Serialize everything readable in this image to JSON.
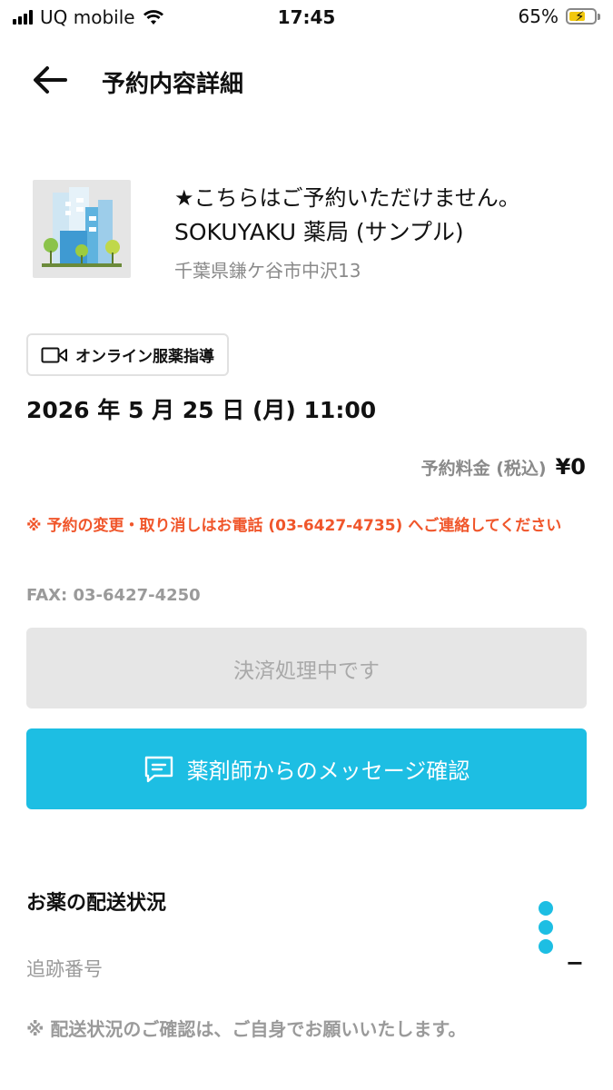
{
  "status_bar": {
    "carrier": "UQ mobile",
    "time": "17:45",
    "battery_percent": "65%",
    "battery_level": 0.65,
    "battery_color": "#f2c80f"
  },
  "header": {
    "title": "予約内容詳細",
    "back_icon": "arrow-left-icon"
  },
  "pharmacy": {
    "notice": "★こちらはご予約いただけません。",
    "name": "SOKUYAKU 薬局 (サンプル)",
    "address": "千葉県鎌ケ谷市中沢13",
    "image_icon": "building-illustration"
  },
  "reservation": {
    "tag_icon": "video-camera-icon",
    "tag_label": "オンライン服薬指導",
    "datetime": "2026 年 5 月 25 日 (月) 11:00",
    "fee_label": "予約料金 (税込)",
    "fee_value": "¥0",
    "warning": "※ 予約の変更・取り消しはお電話 (03-6427-4735) へご連絡してください",
    "fax": "FAX: 03-6427-4250"
  },
  "buttons": {
    "payment_status": "決済処理中です",
    "message_icon": "chat-bubble-icon",
    "message_label": "薬剤師からのメッセージ確認"
  },
  "delivery": {
    "title": "お薬の配送状況",
    "tracking_label": "追跡番号",
    "tracking_value": "−",
    "note": "※ 配送状況のご確認は、ご自身でお願いいたします。"
  },
  "colors": {
    "accent": "#1dbee3",
    "warning": "#f0562b",
    "muted": "#9a9a9a"
  }
}
